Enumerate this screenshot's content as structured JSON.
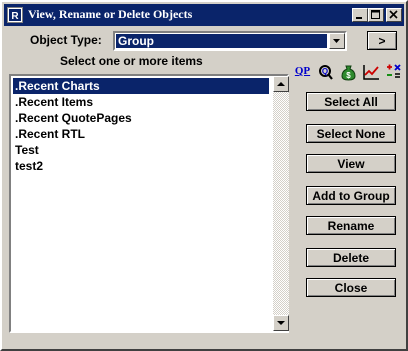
{
  "window": {
    "title": "View, Rename or Delete Objects",
    "controls": {
      "minimize": "minimize",
      "maximize": "maximize",
      "close": "close"
    }
  },
  "object_type": {
    "label": "Object Type:",
    "value": "Group",
    "next_label": ">"
  },
  "list": {
    "caption": "Select one or more items",
    "items": [
      {
        "label": ".Recent Charts",
        "selected": true
      },
      {
        "label": ".Recent Items",
        "selected": false
      },
      {
        "label": ".Recent QuotePages",
        "selected": false
      },
      {
        "label": ".Recent RTL",
        "selected": false
      },
      {
        "label": "Test",
        "selected": false
      },
      {
        "label": "test2",
        "selected": false
      }
    ]
  },
  "toolbar": {
    "qp_label": "QP",
    "icons": [
      "quotepage-icon",
      "search-quote-icon",
      "money-bag-icon",
      "line-chart-icon",
      "calculator-icon"
    ]
  },
  "buttons": {
    "select_all": "Select All",
    "select_none": "Select None",
    "view": "View",
    "add_to_group": "Add to Group",
    "rename": "Rename",
    "delete": "Delete",
    "close": "Close"
  },
  "colors": {
    "face": "#d4d0c8",
    "titlebar": "#0a246a",
    "selection": "#0a246a"
  }
}
